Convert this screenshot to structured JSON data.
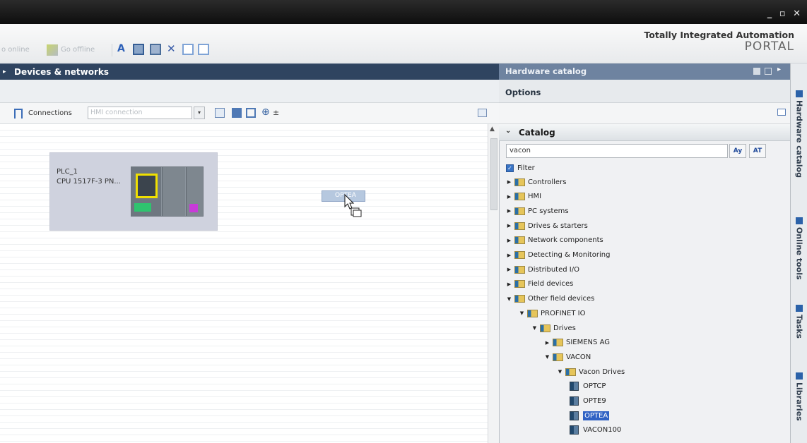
{
  "window": {
    "controls": "_ ▫ ✕"
  },
  "toolbar": {
    "go_online": "o online",
    "go_offline": "Go offline",
    "brand_line1": "Totally Integrated Automation",
    "brand_line2": "PORTAL"
  },
  "editor": {
    "title": "Devices & networks",
    "connections_label": "Connections",
    "connection_type": "HMI connection",
    "plc_name": "PLC_1",
    "plc_type": "CPU 1517F-3 PN...",
    "drag_item": "OPTEA"
  },
  "catalog_panel": {
    "title": "Hardware catalog",
    "options_label": "Options",
    "catalog_label": "Catalog",
    "search_value": "vacon",
    "search_down": "Ay",
    "search_up": "AT",
    "filter_label": "Filter",
    "tree": [
      {
        "label": "Controllers",
        "level": 0,
        "expanded": false,
        "kind": "folder"
      },
      {
        "label": "HMI",
        "level": 0,
        "expanded": false,
        "kind": "folder"
      },
      {
        "label": "PC systems",
        "level": 0,
        "expanded": false,
        "kind": "folder"
      },
      {
        "label": "Drives & starters",
        "level": 0,
        "expanded": false,
        "kind": "folder"
      },
      {
        "label": "Network components",
        "level": 0,
        "expanded": false,
        "kind": "folder"
      },
      {
        "label": "Detecting & Monitoring",
        "level": 0,
        "expanded": false,
        "kind": "folder"
      },
      {
        "label": "Distributed I/O",
        "level": 0,
        "expanded": false,
        "kind": "folder"
      },
      {
        "label": "Field devices",
        "level": 0,
        "expanded": false,
        "kind": "folder"
      },
      {
        "label": "Other field devices",
        "level": 0,
        "expanded": true,
        "kind": "folder"
      },
      {
        "label": "PROFINET IO",
        "level": 1,
        "expanded": true,
        "kind": "folder"
      },
      {
        "label": "Drives",
        "level": 2,
        "expanded": true,
        "kind": "folder"
      },
      {
        "label": "SIEMENS AG",
        "level": 3,
        "expanded": false,
        "kind": "folder"
      },
      {
        "label": "VACON",
        "level": 3,
        "expanded": true,
        "kind": "folder"
      },
      {
        "label": "Vacon Drives",
        "level": 4,
        "expanded": true,
        "kind": "folder"
      },
      {
        "label": "OPTCP",
        "level": 5,
        "kind": "device"
      },
      {
        "label": "OPTE9",
        "level": 5,
        "kind": "device"
      },
      {
        "label": "OPTEA",
        "level": 5,
        "kind": "device",
        "selected": true
      },
      {
        "label": "VACON100",
        "level": 5,
        "kind": "device"
      }
    ]
  },
  "side_tabs": [
    {
      "label": "Hardware catalog",
      "icon": "catalog-icon"
    },
    {
      "label": "Online tools",
      "icon": "online-tools-icon"
    },
    {
      "label": "Tasks",
      "icon": "tasks-icon"
    },
    {
      "label": "Libraries",
      "icon": "libraries-icon"
    }
  ]
}
